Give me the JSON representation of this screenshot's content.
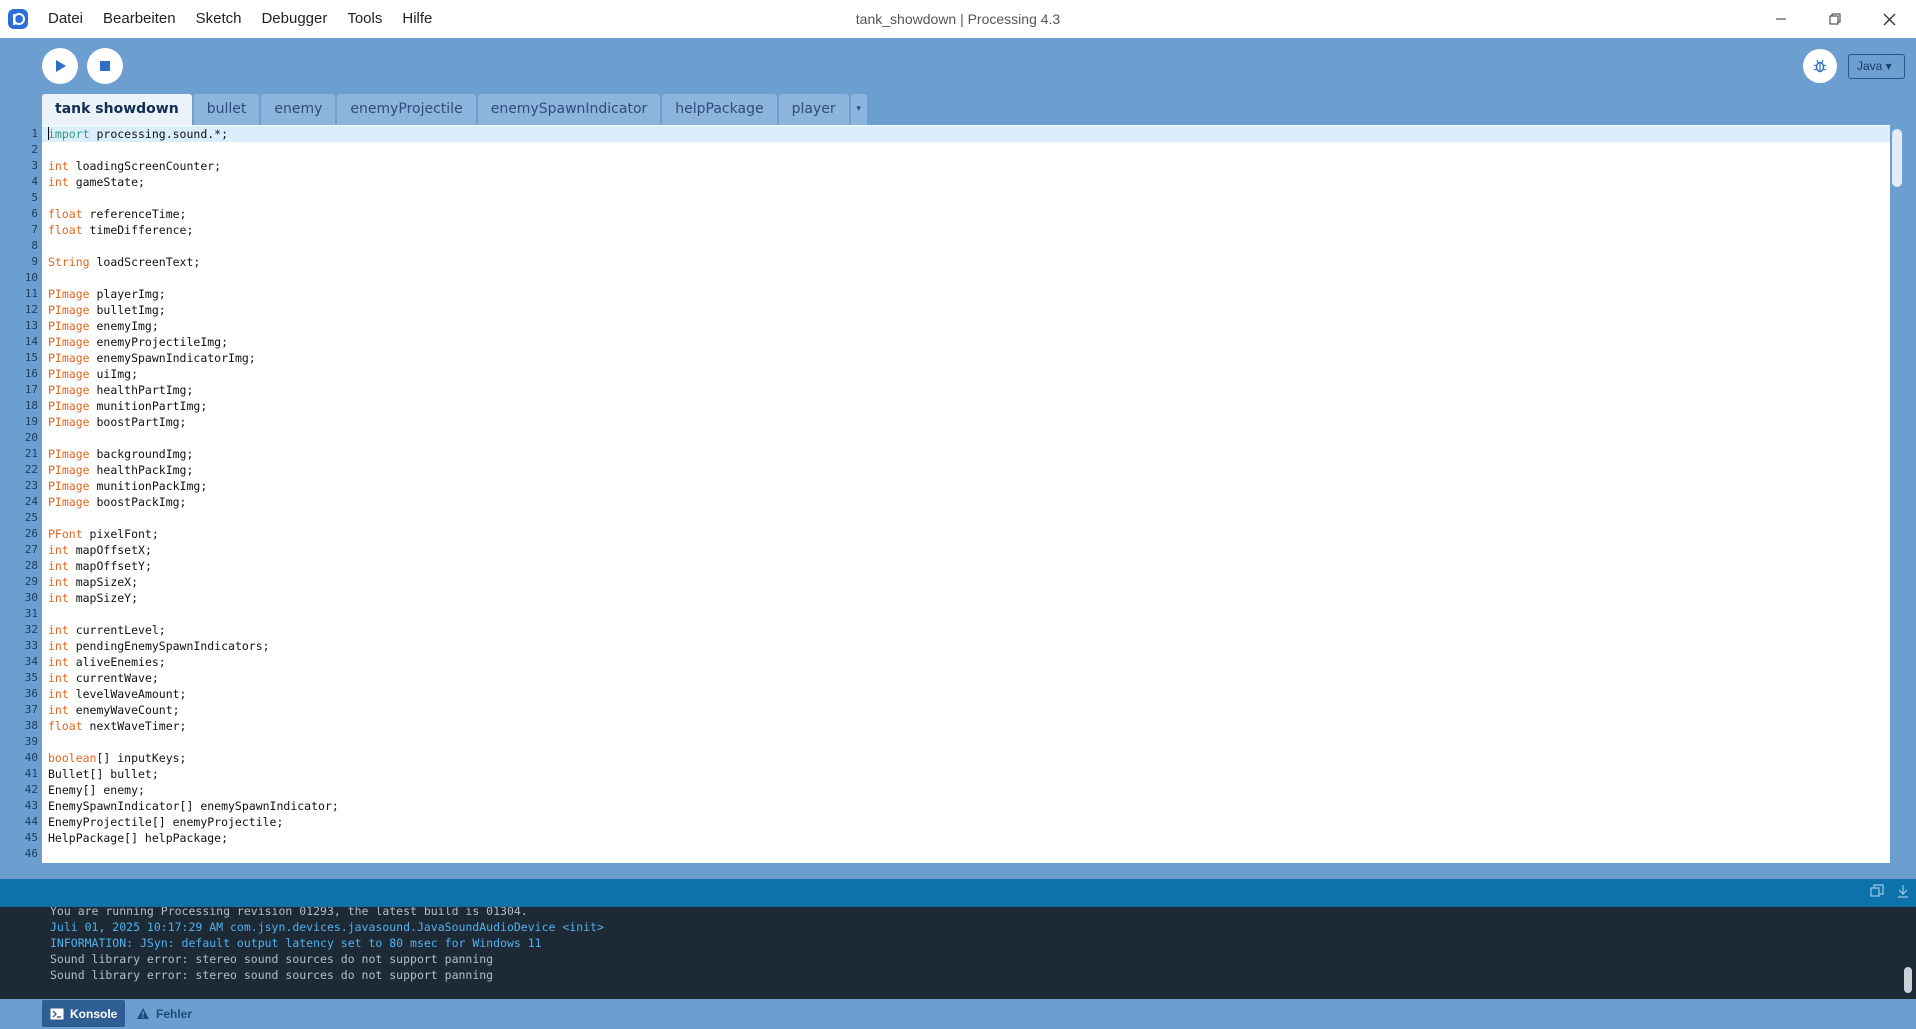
{
  "window": {
    "title": "tank_showdown | Processing 4.3",
    "menu": [
      "Datei",
      "Bearbeiten",
      "Sketch",
      "Debugger",
      "Tools",
      "Hilfe"
    ]
  },
  "toolbar": {
    "run_icon": "play-icon",
    "stop_icon": "stop-icon",
    "debug_icon": "debugger-icon",
    "mode": "Java ▾"
  },
  "tabs": [
    {
      "label": "tank showdown",
      "active": true
    },
    {
      "label": "bullet"
    },
    {
      "label": "enemy"
    },
    {
      "label": "enemyProjectile"
    },
    {
      "label": "enemySpawnIndicator"
    },
    {
      "label": "helpPackage"
    },
    {
      "label": "player"
    }
  ],
  "tab_menu_glyph": "▾",
  "editor": {
    "current_line": 1,
    "lines": [
      {
        "kw": "import",
        "rest": " processing.sound.*;"
      },
      {
        "kw": "",
        "rest": ""
      },
      {
        "kw": "int",
        "rest": " loadingScreenCounter;"
      },
      {
        "kw": "int",
        "rest": " gameState;"
      },
      {
        "kw": "",
        "rest": ""
      },
      {
        "kw": "float",
        "rest": " referenceTime;"
      },
      {
        "kw": "float",
        "rest": " timeDifference;"
      },
      {
        "kw": "",
        "rest": ""
      },
      {
        "kw": "String",
        "rest": " loadScreenText;"
      },
      {
        "kw": "",
        "rest": ""
      },
      {
        "kw": "PImage",
        "rest": " playerImg;"
      },
      {
        "kw": "PImage",
        "rest": " bulletImg;"
      },
      {
        "kw": "PImage",
        "rest": " enemyImg;"
      },
      {
        "kw": "PImage",
        "rest": " enemyProjectileImg;"
      },
      {
        "kw": "PImage",
        "rest": " enemySpawnIndicatorImg;"
      },
      {
        "kw": "PImage",
        "rest": " uiImg;"
      },
      {
        "kw": "PImage",
        "rest": " healthPartImg;"
      },
      {
        "kw": "PImage",
        "rest": " munitionPartImg;"
      },
      {
        "kw": "PImage",
        "rest": " boostPartImg;"
      },
      {
        "kw": "",
        "rest": ""
      },
      {
        "kw": "PImage",
        "rest": " backgroundImg;"
      },
      {
        "kw": "PImage",
        "rest": " healthPackImg;"
      },
      {
        "kw": "PImage",
        "rest": " munitionPackImg;"
      },
      {
        "kw": "PImage",
        "rest": " boostPackImg;"
      },
      {
        "kw": "",
        "rest": ""
      },
      {
        "kw": "PFont",
        "rest": " pixelFont;"
      },
      {
        "kw": "int",
        "rest": " mapOffsetX;"
      },
      {
        "kw": "int",
        "rest": " mapOffsetY;"
      },
      {
        "kw": "int",
        "rest": " mapSizeX;"
      },
      {
        "kw": "int",
        "rest": " mapSizeY;"
      },
      {
        "kw": "",
        "rest": ""
      },
      {
        "kw": "int",
        "rest": " currentLevel;"
      },
      {
        "kw": "int",
        "rest": " pendingEnemySpawnIndicators;"
      },
      {
        "kw": "int",
        "rest": " aliveEnemies;"
      },
      {
        "kw": "int",
        "rest": " currentWave;"
      },
      {
        "kw": "int",
        "rest": " levelWaveAmount;"
      },
      {
        "kw": "int",
        "rest": " enemyWaveCount;"
      },
      {
        "kw": "float",
        "rest": " nextWaveTimer;"
      },
      {
        "kw": "",
        "rest": ""
      },
      {
        "kw": "boolean",
        "rest": "[] inputKeys;"
      },
      {
        "kw": "",
        "rest": "Bullet[] bullet;"
      },
      {
        "kw": "",
        "rest": "Enemy[] enemy;"
      },
      {
        "kw": "",
        "rest": "EnemySpawnIndicator[] enemySpawnIndicator;"
      },
      {
        "kw": "",
        "rest": "EnemyProjectile[] enemyProjectile;"
      },
      {
        "kw": "",
        "rest": "HelpPackage[] helpPackage;"
      },
      {
        "kw": "",
        "rest": ""
      }
    ]
  },
  "console": {
    "lines": [
      {
        "text": "You are running Processing revision 01293, the latest build is 01304.",
        "color": "grey"
      },
      {
        "text": "Juli 01, 2025 10:17:29 AM com.jsyn.devices.javasound.JavaSoundAudioDevice <init>",
        "color": "blue"
      },
      {
        "text": "INFORMATION: JSyn: default output latency set to 80 msec for Windows 11",
        "color": "blue"
      },
      {
        "text": "Sound library error: stereo sound sources do not support panning",
        "color": "grey"
      },
      {
        "text": "Sound library error: stereo sound sources do not support panning",
        "color": "grey"
      }
    ]
  },
  "footer": {
    "console_label": "Konsole",
    "errors_label": "Fehler"
  }
}
